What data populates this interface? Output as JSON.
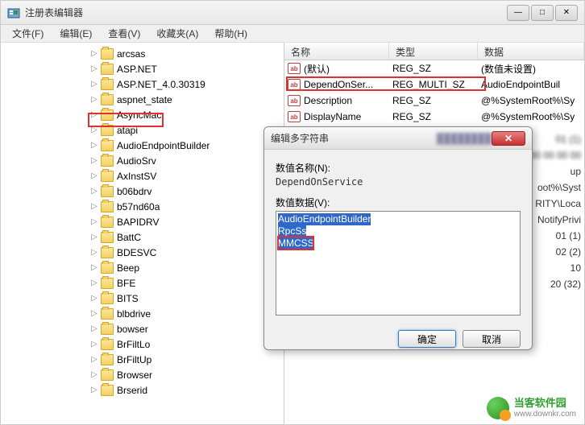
{
  "window": {
    "title": "注册表编辑器"
  },
  "menu": {
    "file": "文件(F)",
    "edit": "编辑(E)",
    "view": "查看(V)",
    "favorites": "收藏夹(A)",
    "help": "帮助(H)"
  },
  "tree": {
    "items": [
      "arcsas",
      "ASP.NET",
      "ASP.NET_4.0.30319",
      "aspnet_state",
      "AsyncMac",
      "atapi",
      "AudioEndpointBuilder",
      "AudioSrv",
      "AxInstSV",
      "b06bdrv",
      "b57nd60a",
      "BAPIDRV",
      "BattC",
      "BDESVC",
      "Beep",
      "BFE",
      "BITS",
      "blbdrive",
      "bowser",
      "BrFiltLo",
      "BrFiltUp",
      "Browser",
      "Brserid"
    ]
  },
  "list": {
    "headers": {
      "name": "名称",
      "type": "类型",
      "data": "数据"
    },
    "rows": [
      {
        "name": "(默认)",
        "type": "REG_SZ",
        "data": "(数值未设置)"
      },
      {
        "name": "DependOnSer...",
        "type": "REG_MULTI_SZ",
        "data": "AudioEndpointBuil"
      },
      {
        "name": "Description",
        "type": "REG_SZ",
        "data": "@%SystemRoot%\\Sy"
      },
      {
        "name": "DisplayName",
        "type": "REG_SZ",
        "data": "@%SystemRoot%\\Sy"
      }
    ],
    "ghost_rows": [
      "01 (1)",
      "00 00 00 00",
      "up",
      "oot%\\Syst",
      "RITY\\Loca",
      "NotifyPrivi",
      "01 (1)",
      "02 (2)",
      "10",
      "20 (32)"
    ]
  },
  "dialog": {
    "title": "编辑多字符串",
    "name_label": "数值名称(N):",
    "name_value": "DependOnService",
    "data_label": "数值数据(V):",
    "lines": [
      "AudioEndpointBuilder",
      "RpcSs",
      "MMCSS"
    ],
    "ok": "确定",
    "cancel": "取消"
  },
  "watermark": {
    "name": "当客软件园",
    "url": "www.downkr.com"
  }
}
